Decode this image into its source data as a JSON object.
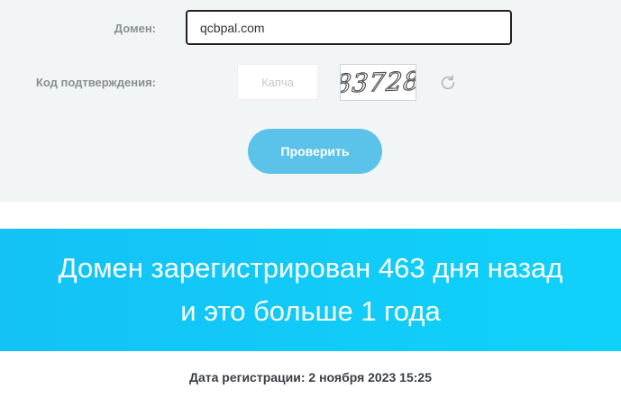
{
  "form": {
    "domain_label": "Домен:",
    "domain_value": "qcbpal.com",
    "captcha_label": "Код подтверждения:",
    "captcha_placeholder": "Капча",
    "captcha_value": "",
    "captcha_code": "83728",
    "check_label": "Проверить"
  },
  "result": {
    "line1": "Домен зарегистрирован 463 дня назад",
    "line2": "и это больше 1 года",
    "registration_date": "Дата регистрации: 2 ноября 2023 15:25"
  },
  "colors": {
    "accent": "#5bc3ea",
    "banner": "#14c2f6",
    "form_bg": "#f2f5f6"
  },
  "icons": {
    "refresh": "refresh-icon"
  }
}
